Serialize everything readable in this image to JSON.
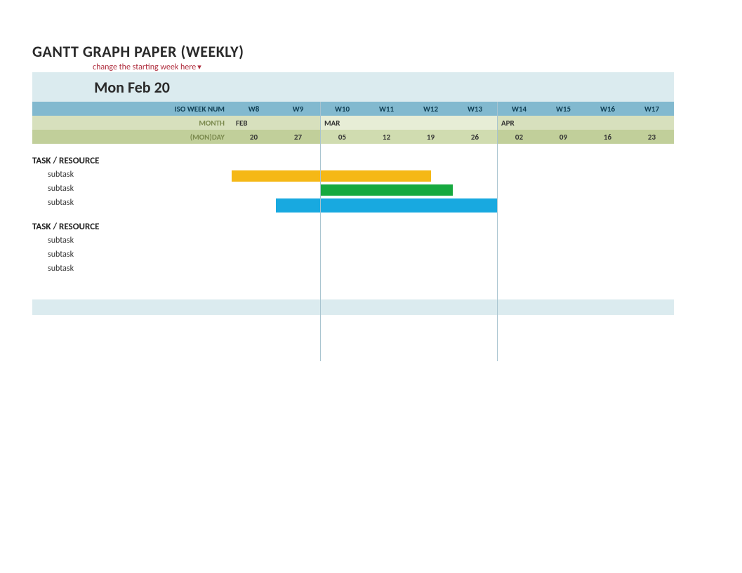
{
  "title": "GANTT GRAPH PAPER (WEEKLY)",
  "hint": "change the starting week here",
  "start_week_label": "Mon Feb 20",
  "iso_label": "ISO WEEK NUM",
  "month_label": "MONTH",
  "day_label": "(MON)DAY",
  "weeks": [
    "W8",
    "W9",
    "W10",
    "W11",
    "W12",
    "W13",
    "W14",
    "W15",
    "W16",
    "W17"
  ],
  "months": [
    {
      "label": "FEB",
      "span": 2,
      "alt": false
    },
    {
      "label": "MAR",
      "span": 4,
      "alt": true
    },
    {
      "label": "APR",
      "span": 4,
      "alt": false
    }
  ],
  "days": [
    {
      "d": "20",
      "alt": false
    },
    {
      "d": "27",
      "alt": false
    },
    {
      "d": "05",
      "alt": true
    },
    {
      "d": "12",
      "alt": true
    },
    {
      "d": "19",
      "alt": true
    },
    {
      "d": "26",
      "alt": true
    },
    {
      "d": "09",
      "alt": false,
      "pre": "02"
    },
    {
      "d": "09",
      "alt": false
    },
    {
      "d": "16",
      "alt": false
    },
    {
      "d": "23",
      "alt": false
    }
  ],
  "days_flat": [
    "20",
    "27",
    "05",
    "12",
    "19",
    "26",
    "02",
    "09",
    "16",
    "23"
  ],
  "days_alt": [
    false,
    false,
    true,
    true,
    true,
    true,
    false,
    false,
    false,
    false
  ],
  "month_cells": [
    {
      "text": "FEB",
      "alt": false
    },
    {
      "text": "",
      "alt": false
    },
    {
      "text": "MAR",
      "alt": true
    },
    {
      "text": "",
      "alt": true
    },
    {
      "text": "",
      "alt": true
    },
    {
      "text": "",
      "alt": true
    },
    {
      "text": "APR",
      "alt": false
    },
    {
      "text": "",
      "alt": false
    },
    {
      "text": "",
      "alt": false
    },
    {
      "text": "",
      "alt": false
    }
  ],
  "colors": {
    "bar_yellow": "#f5b816",
    "bar_green": "#16a93f",
    "bar_blue": "#18a9e0"
  },
  "groups": [
    {
      "name": "TASK / RESOURCE",
      "tasks": [
        {
          "label": "subtask",
          "start": 0,
          "span": 4.5,
          "color": "bar_yellow"
        },
        {
          "label": "subtask",
          "start": 2,
          "span": 3,
          "color": "bar_green"
        },
        {
          "label": "subtask",
          "start": 1,
          "span": 5,
          "color": "bar_blue"
        }
      ]
    },
    {
      "name": "TASK / RESOURCE",
      "tasks": [
        {
          "label": "subtask"
        },
        {
          "label": "subtask"
        },
        {
          "label": "subtask"
        }
      ]
    }
  ],
  "chart_data": {
    "type": "gantt",
    "unit": "iso_week",
    "x_categories": [
      "W8",
      "W9",
      "W10",
      "W11",
      "W12",
      "W13",
      "W14",
      "W15",
      "W16",
      "W17"
    ],
    "x_dates": [
      "Feb 20",
      "Feb 27",
      "Mar 05",
      "Mar 12",
      "Mar 19",
      "Mar 26",
      "Apr 02",
      "Apr 09",
      "Apr 16",
      "Apr 23"
    ],
    "series": [
      {
        "group": "TASK / RESOURCE",
        "name": "subtask",
        "start": "W8",
        "end": "W12",
        "mid_end": true,
        "color": "#f5b816"
      },
      {
        "group": "TASK / RESOURCE",
        "name": "subtask",
        "start": "W10",
        "end": "W12",
        "color": "#16a93f"
      },
      {
        "group": "TASK / RESOURCE",
        "name": "subtask",
        "start": "W9",
        "end": "W13",
        "color": "#18a9e0"
      },
      {
        "group": "TASK / RESOURCE (2)",
        "name": "subtask"
      },
      {
        "group": "TASK / RESOURCE (2)",
        "name": "subtask"
      },
      {
        "group": "TASK / RESOURCE (2)",
        "name": "subtask"
      }
    ],
    "title": "GANTT GRAPH PAPER (WEEKLY)"
  }
}
